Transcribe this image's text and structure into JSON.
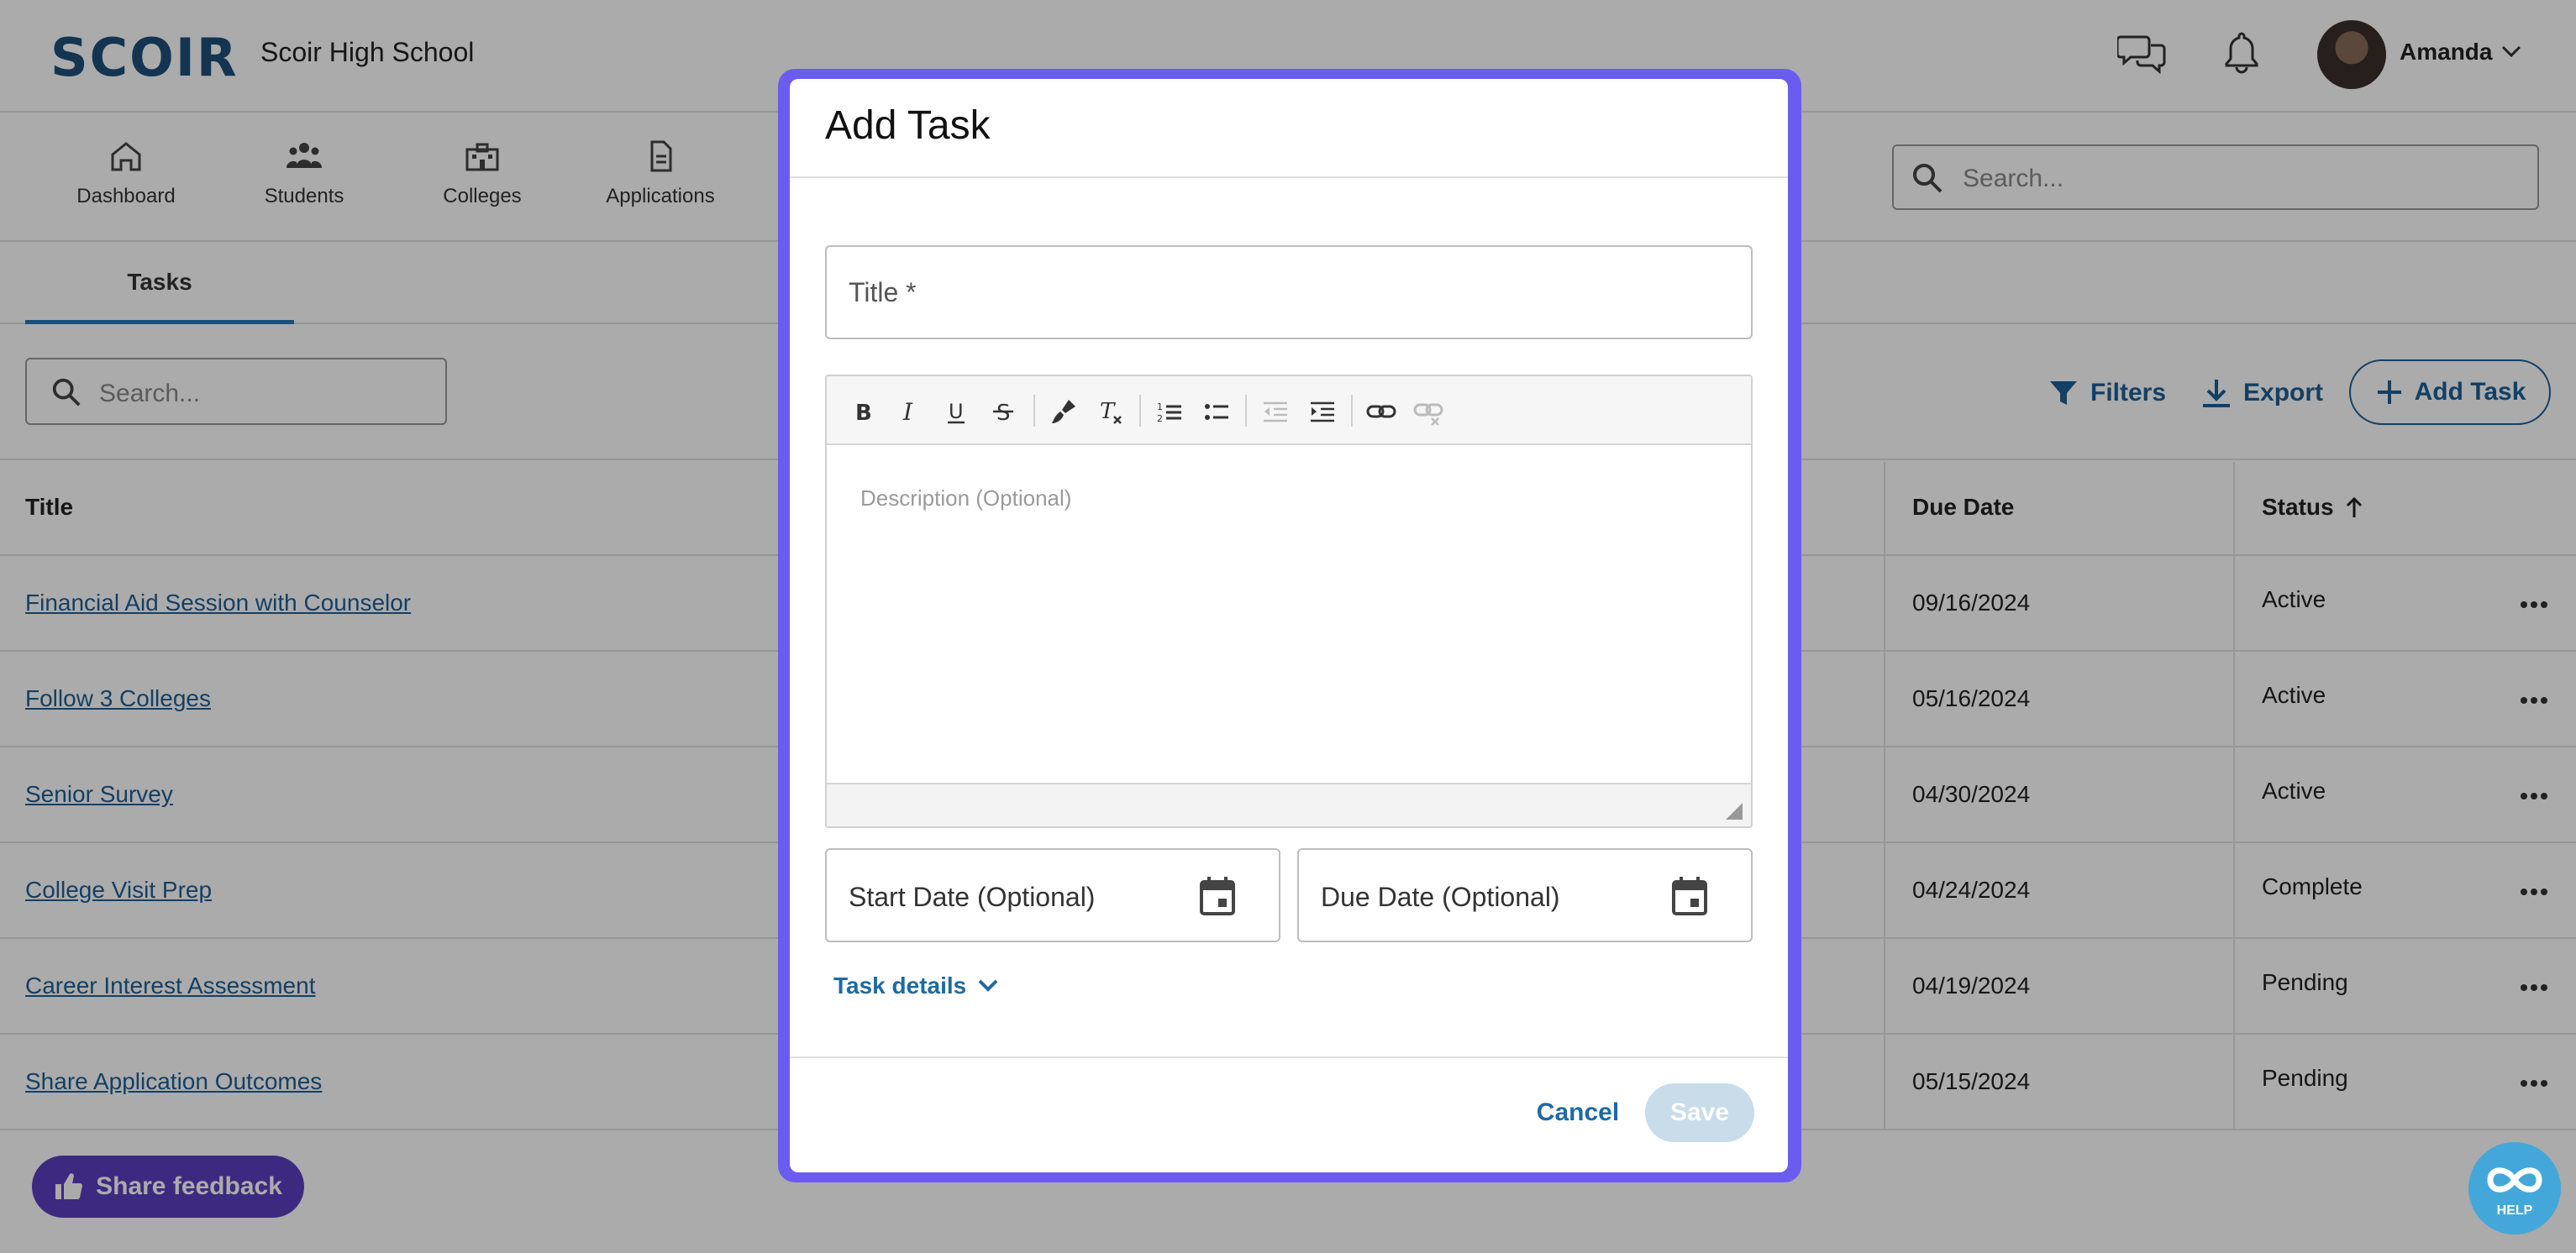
{
  "header": {
    "logo_text": "SCOIR",
    "school_name": "Scoir High School",
    "user_name": "Amanda"
  },
  "nav": {
    "items": [
      {
        "label": "Dashboard",
        "icon": "home-icon"
      },
      {
        "label": "Students",
        "icon": "students-icon"
      },
      {
        "label": "Colleges",
        "icon": "colleges-icon"
      },
      {
        "label": "Applications",
        "icon": "document-icon"
      }
    ],
    "search_placeholder": "Search..."
  },
  "subtabs": {
    "active": "Tasks"
  },
  "toolbar": {
    "search_placeholder": "Search...",
    "filters_label": "Filters",
    "export_label": "Export",
    "add_task_label": "Add Task"
  },
  "table": {
    "columns": {
      "title": "Title",
      "due_date": "Due Date",
      "status": "Status"
    },
    "rows": [
      {
        "title": "Financial Aid Session with Counselor",
        "due_date": "09/16/2024",
        "status": "Active"
      },
      {
        "title": "Follow 3 Colleges",
        "due_date": "05/16/2024",
        "status": "Active"
      },
      {
        "title": "Senior Survey",
        "due_date": "04/30/2024",
        "status": "Active"
      },
      {
        "title": "College Visit Prep",
        "due_date": "04/24/2024",
        "status": "Complete"
      },
      {
        "title": "Career Interest Assessment",
        "due_date": "04/19/2024",
        "status": "Pending"
      },
      {
        "title": "Share Application Outcomes",
        "due_date": "05/15/2024",
        "status": "Pending"
      }
    ]
  },
  "footer": {
    "feedback_label": "Share feedback",
    "help_label": "HELP"
  },
  "modal": {
    "title": "Add Task",
    "title_field_label": "Title *",
    "description_placeholder": "Description (Optional)",
    "start_date_label": "Start Date (Optional)",
    "due_date_label": "Due Date (Optional)",
    "details_toggle_label": "Task details",
    "cancel_label": "Cancel",
    "save_label": "Save"
  },
  "colors": {
    "modal_frame": "#6b5cf0",
    "link_blue": "#1f5f95",
    "feedback_purple": "#5a3fc0",
    "help_blue": "#43a8d9",
    "save_disabled": "#c8dcea"
  }
}
